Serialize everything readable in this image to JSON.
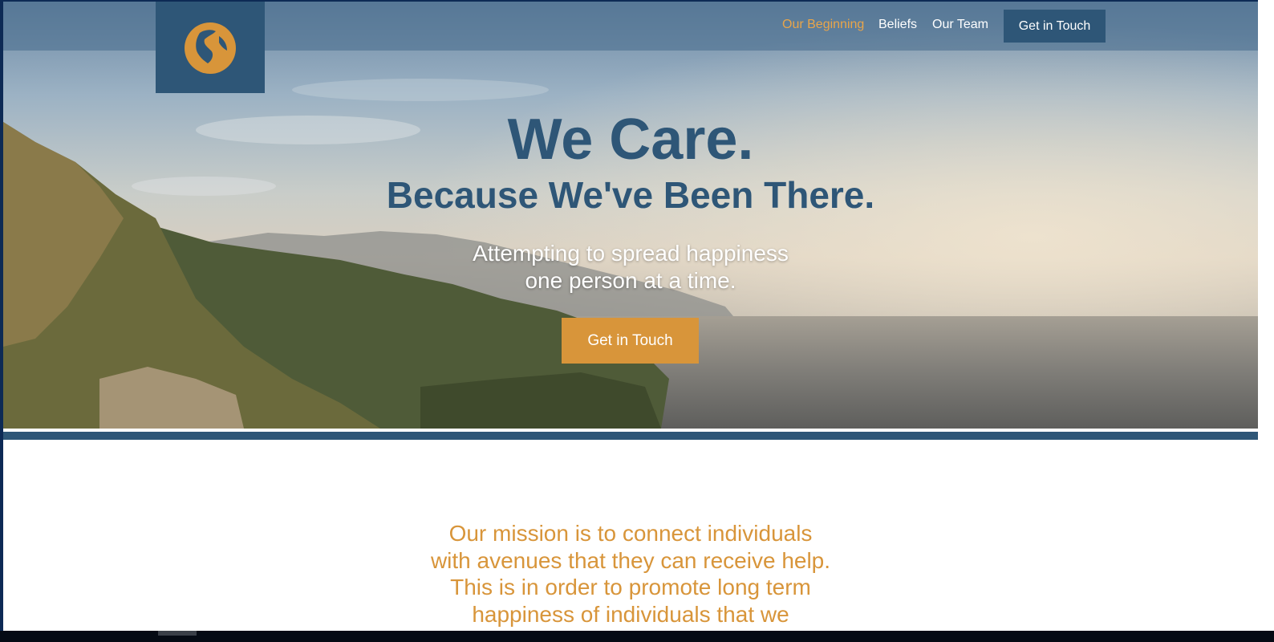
{
  "nav": {
    "links": [
      "Our Beginning",
      "Beliefs",
      "Our Team"
    ],
    "active": "Our Beginning",
    "cta_label": "Get in Touch"
  },
  "logo": {
    "icon": "globe-icon"
  },
  "hero": {
    "title": "We Care.",
    "subtitle": "Because We've Been There.",
    "tagline_line1": "Attempting to spread happiness",
    "tagline_line2": "one person at a time.",
    "cta_label": "Get in Touch"
  },
  "mission": {
    "text": "Our mission is to connect individuals with avenues that they can receive help. This is in order to promote long term happiness of individuals that we"
  },
  "colors": {
    "brand_blue": "#2e5677",
    "accent_orange": "#d8953a",
    "active_link": "#e9a54a"
  }
}
